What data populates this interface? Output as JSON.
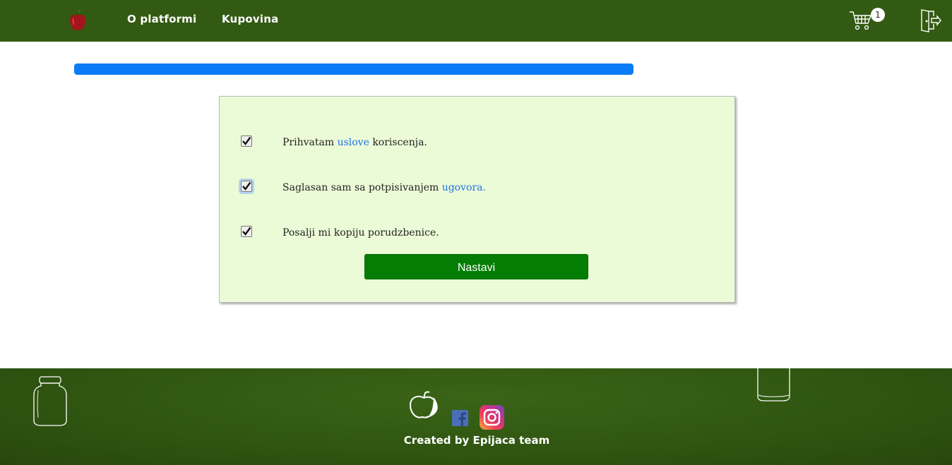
{
  "nav": {
    "about_label": "O platformi",
    "shop_label": "Kupovina",
    "cart_count": "1"
  },
  "progress": {
    "percent": 100,
    "color": "#0a7cf6"
  },
  "agreement": {
    "rows": [
      {
        "before": "Prihvatam ",
        "link": "uslove",
        "after": " koriscenja.",
        "checked": true
      },
      {
        "before": "Saglasan sam sa potpisivanjem ",
        "link": "ugovora.",
        "after": "",
        "checked": true
      },
      {
        "before": "Posalji mi kopiju porudzbenice.",
        "link": "",
        "after": "",
        "checked": true
      }
    ],
    "continue_label": "Nastavi"
  },
  "footer": {
    "credit": "Created by Epijaca team"
  },
  "colors": {
    "header_bg": "#335a12",
    "card_bg": "#ecfbd7",
    "button_bg": "#047d04",
    "link": "#1a73e8"
  },
  "icons": [
    "apple-logo-icon",
    "cart-icon",
    "logout-door-icon",
    "checkmark-icon",
    "jar-icon",
    "facebook-icon",
    "instagram-icon"
  ]
}
